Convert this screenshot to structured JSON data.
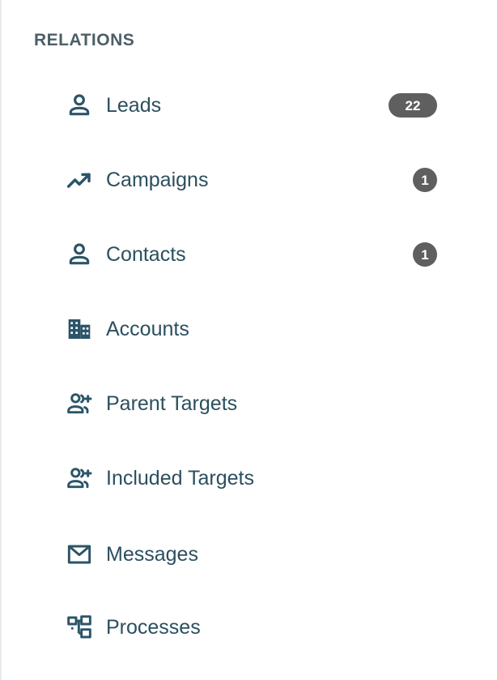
{
  "panel": {
    "section_title": "RELATIONS",
    "items": [
      {
        "label": "Leads",
        "icon": "person-icon",
        "badge": "22"
      },
      {
        "label": "Campaigns",
        "icon": "trending-up-icon",
        "badge": "1"
      },
      {
        "label": "Contacts",
        "icon": "person-icon",
        "badge": "1"
      },
      {
        "label": "Accounts",
        "icon": "building-icon",
        "badge": ""
      },
      {
        "label": "Parent Targets",
        "icon": "people-plus-icon",
        "badge": ""
      },
      {
        "label": "Included Targets",
        "icon": "people-plus-icon",
        "badge": ""
      },
      {
        "label": "Messages",
        "icon": "envelope-icon",
        "badge": ""
      },
      {
        "label": "Processes",
        "icon": "process-flow-icon",
        "badge": ""
      }
    ]
  },
  "colors": {
    "icon": "#2b5568",
    "label": "#2b4f5e",
    "title": "#4d5e66",
    "badge_bg": "#5f5f5f",
    "badge_text": "#ffffff",
    "border": "#e9ecee"
  }
}
